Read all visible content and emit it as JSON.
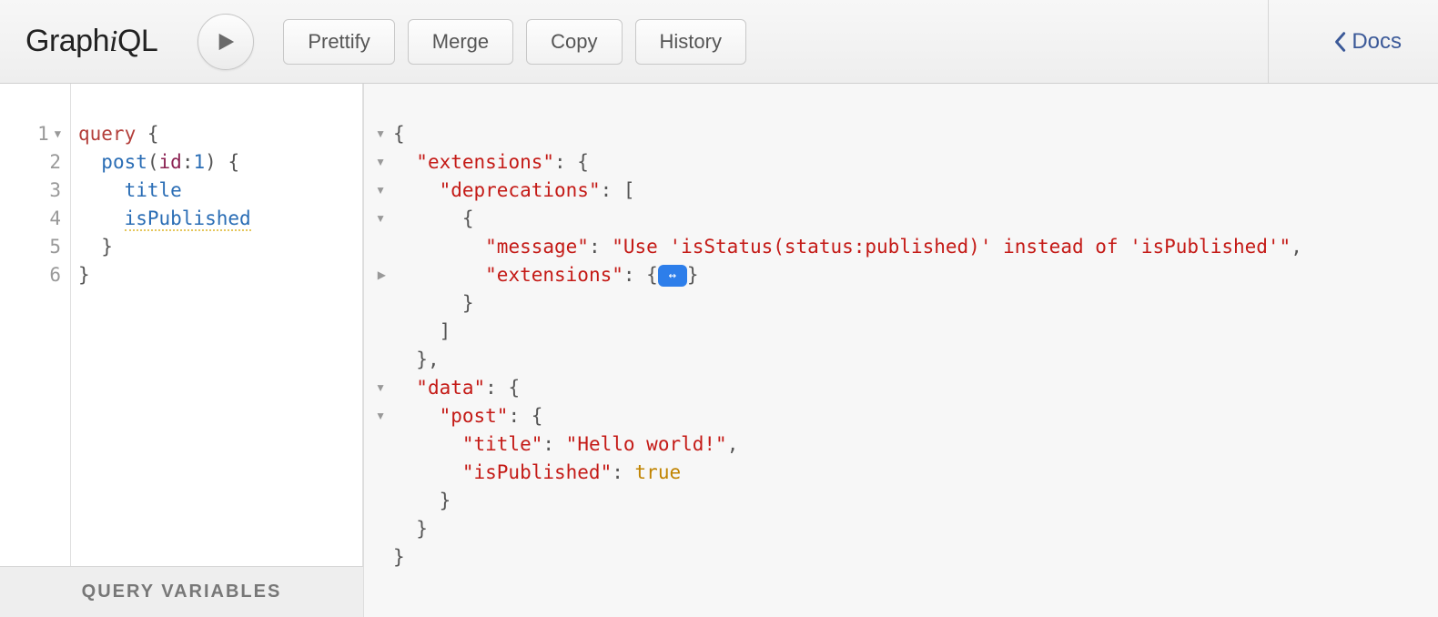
{
  "app": {
    "name": "GraphiQL"
  },
  "toolbar": {
    "prettify": "Prettify",
    "merge": "Merge",
    "copy": "Copy",
    "history": "History",
    "docs": "Docs"
  },
  "editor": {
    "line_numbers": [
      "1",
      "2",
      "3",
      "4",
      "5",
      "6"
    ],
    "query": {
      "keyword": "query",
      "root_open": " {",
      "post_fn": "post",
      "post_args_open": "(",
      "post_arg_name": "id",
      "post_arg_colon": ":",
      "post_arg_value": "1",
      "post_args_close": ")",
      "post_block_open": " {",
      "field_title": "title",
      "field_isPublished": "isPublished",
      "post_block_close": "}",
      "root_close": "}"
    },
    "variables_label": "Query Variables"
  },
  "result": {
    "tokens": {
      "open": "{",
      "extensions_key": "\"extensions\"",
      "deprecations_key": "\"deprecations\"",
      "message_key": "\"message\"",
      "message_val": "\"Use 'isStatus(status:published)' instead of 'isPublished'\"",
      "inner_extensions_key": "\"extensions\"",
      "collapsed_open": "{",
      "collapsed_badge": "↔",
      "collapsed_close": "}",
      "data_key": "\"data\"",
      "post_key": "\"post\"",
      "title_key": "\"title\"",
      "title_val": "\"Hello world!\"",
      "isPublished_key": "\"isPublished\"",
      "isPublished_val": "true",
      "close": "}"
    }
  }
}
